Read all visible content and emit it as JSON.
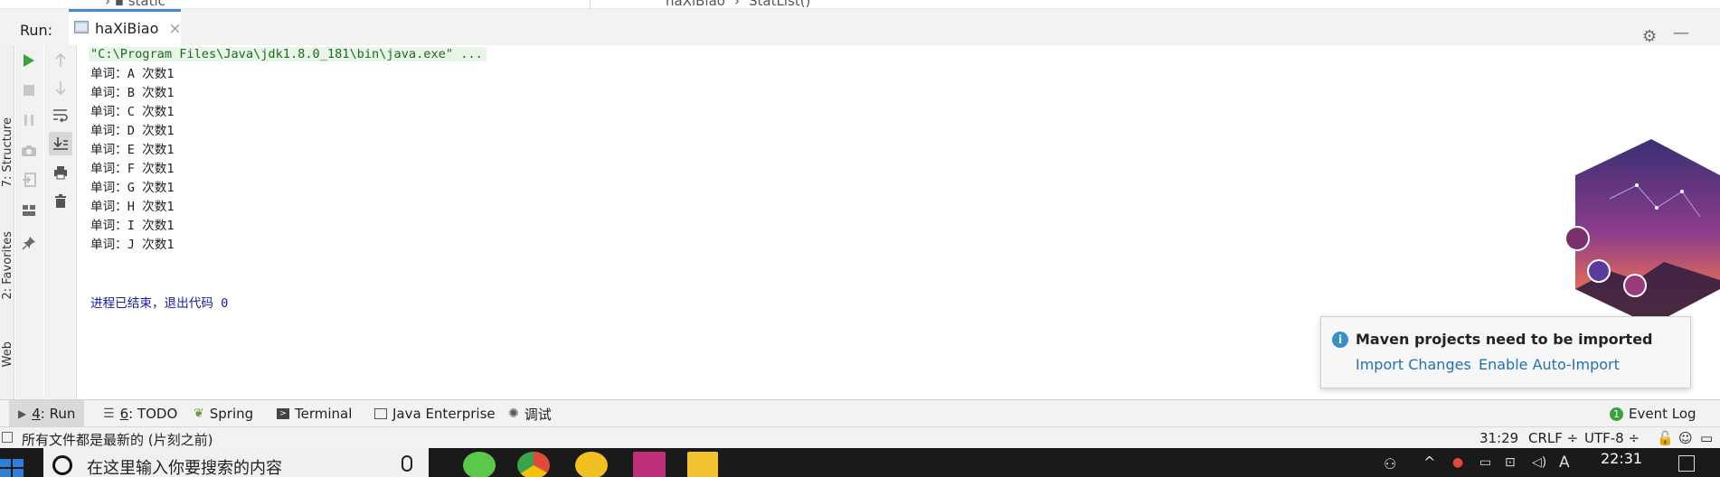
{
  "top_strip": {
    "folder": "static",
    "breadcrumb_class": "haXiBiao",
    "breadcrumb_method": "StatList()"
  },
  "run_panel": {
    "label": "Run:",
    "tab_title": "haXiBiao",
    "tab_close": "×"
  },
  "left_strip": {
    "structure": "7: Structure",
    "favorites": "2: Favorites",
    "web": "Web"
  },
  "toolbar_icons": [
    "play-icon",
    "stop-icon",
    "pause-icon",
    "camera-icon",
    "login-icon",
    "layout-icon",
    "pin-icon",
    "up-arrow-icon",
    "down-arrow-icon",
    "soft-wrap-icon",
    "scroll-to-end-icon",
    "print-icon",
    "trash-icon"
  ],
  "console": {
    "command": "\"C:\\Program Files\\Java\\jdk1.8.0_181\\bin\\java.exe\" ...",
    "lines": [
      "单词：A 次数1",
      "单词：B 次数1",
      "单词：C 次数1",
      "单词：D 次数1",
      "单词：E 次数1",
      "单词：F 次数1",
      "单词：G 次数1",
      "单词：H 次数1",
      "单词：I 次数1",
      "单词：J 次数1"
    ],
    "exit_message": "进程已结束，退出代码 0"
  },
  "bottom_tabs": {
    "run_num": "4",
    "run": ": Run",
    "todo_num": "6",
    "todo": ": TODO",
    "spring": "Spring",
    "terminal": "Terminal",
    "java_enterprise": "Java Enterprise",
    "debug": "调试",
    "event_log": "Event Log"
  },
  "status_bar": {
    "message": "所有文件都是最新的 (片刻之前)",
    "position": "31:29",
    "line_separator": "CRLF ÷",
    "encoding": "UTF-8 ÷"
  },
  "notification": {
    "title": "Maven projects need to be imported",
    "import_changes": "Import Changes",
    "enable_auto_import": "Enable Auto-Import"
  },
  "taskbar": {
    "search_placeholder": "在这里输入你要搜索的内容",
    "clock": "22:31",
    "ime": "A"
  },
  "colors": {
    "accent": "#4a88c7",
    "run_green": "#3aa23a",
    "link_blue": "#2470b3",
    "console_blue": "#1a1aa6"
  }
}
